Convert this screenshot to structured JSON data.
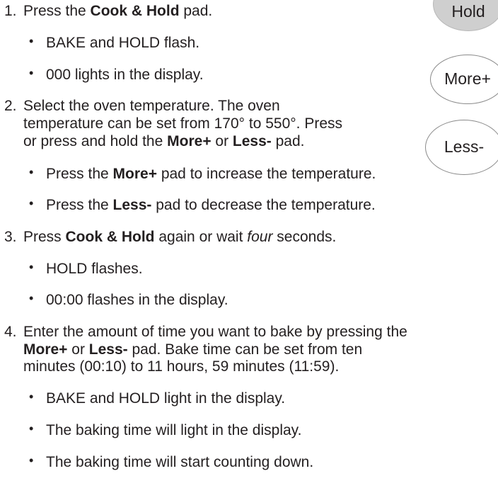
{
  "pads": {
    "hold": "Hold",
    "more": "More+",
    "less": "Less-"
  },
  "steps": [
    {
      "num": "1.",
      "parts": [
        "Press the ",
        "Cook & Hold",
        " pad."
      ],
      "bullets": [
        "BAKE and HOLD flash.",
        "000 lights in the display."
      ]
    },
    {
      "num": "2.",
      "line1": "Select the oven temperature.  The oven",
      "line2": "temperature can be set from 170° to 550°.  Press",
      "line3_parts": [
        "or press and hold the ",
        "More+",
        " or ",
        "Less-",
        " pad."
      ],
      "bullets": [
        {
          "parts": [
            "Press the ",
            "More+",
            " pad to increase the temperature."
          ]
        },
        {
          "parts": [
            "Press the ",
            "Less-",
            " pad to decrease the temperature."
          ]
        }
      ]
    },
    {
      "num": "3.",
      "parts": [
        "Press ",
        "Cook & Hold",
        " again or wait ",
        "four",
        " seconds."
      ],
      "bullets": [
        "HOLD flashes.",
        "00:00 flashes in the display."
      ]
    },
    {
      "num": "4.",
      "line1": "Enter the amount of time you want to bake by pressing the",
      "line2_parts": [
        "More+",
        " or ",
        "Less-",
        " pad.  Bake time can be set from ten"
      ],
      "line3": "minutes (00:10) to 11 hours, 59 minutes (11:59).",
      "bullets": [
        "BAKE and HOLD light in the display.",
        "The baking time will light in the display.",
        "The baking time will start counting down."
      ]
    }
  ],
  "bullet_glyph": "•"
}
